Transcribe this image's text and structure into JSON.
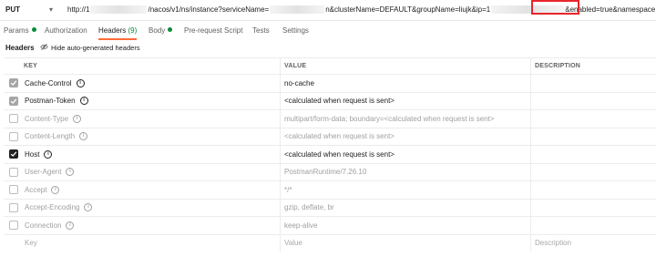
{
  "request": {
    "method": "PUT",
    "url_prefix": "http://1",
    "url_part2": "/nacos/v1/ns/instance?serviceName=",
    "url_part3": "n&clusterName=DEFAULT&groupName=liujk&ip=1",
    "url_highlight": "&enabled=true",
    "url_part4": "&namespaceId=liujk"
  },
  "tabs": [
    {
      "label": "Params",
      "dot": true
    },
    {
      "label": "Authorization"
    },
    {
      "label": "Headers",
      "count": "(9)",
      "active": true
    },
    {
      "label": "Body",
      "dot": true
    },
    {
      "label": "Pre-request Script"
    },
    {
      "label": "Tests"
    },
    {
      "label": "Settings"
    }
  ],
  "subheader": {
    "title": "Headers",
    "toggle_label": "Hide auto-generated headers"
  },
  "table": {
    "columns": {
      "key": "KEY",
      "value": "VALUE",
      "description": "DESCRIPTION"
    },
    "rows": [
      {
        "key": "Cache-Control",
        "value": "no-cache",
        "checked": "grey",
        "disabled": false
      },
      {
        "key": "Postman-Token",
        "value": "<calculated when request is sent>",
        "checked": "grey",
        "disabled": false
      },
      {
        "key": "Content-Type",
        "value": "multipart/form-data; boundary=<calculated when request is sent>",
        "checked": "none",
        "disabled": true
      },
      {
        "key": "Content-Length",
        "value": "<calculated when request is sent>",
        "checked": "none",
        "disabled": true
      },
      {
        "key": "Host",
        "value": "<calculated when request is sent>",
        "checked": "dark",
        "disabled": false
      },
      {
        "key": "User-Agent",
        "value": "PostmanRuntime/7.26.10",
        "checked": "none",
        "disabled": true
      },
      {
        "key": "Accept",
        "value": "*/*",
        "checked": "none",
        "disabled": true
      },
      {
        "key": "Accept-Encoding",
        "value": "gzip, deflate, br",
        "checked": "none",
        "disabled": true
      },
      {
        "key": "Connection",
        "value": "keep-alive",
        "checked": "none",
        "disabled": true
      }
    ],
    "placeholder": {
      "key": "Key",
      "value": "Value",
      "description": "Description"
    }
  },
  "colors": {
    "accent": "#ff6c37",
    "highlight_border": "#e8262c",
    "active_dot": "#0b8a3a"
  }
}
